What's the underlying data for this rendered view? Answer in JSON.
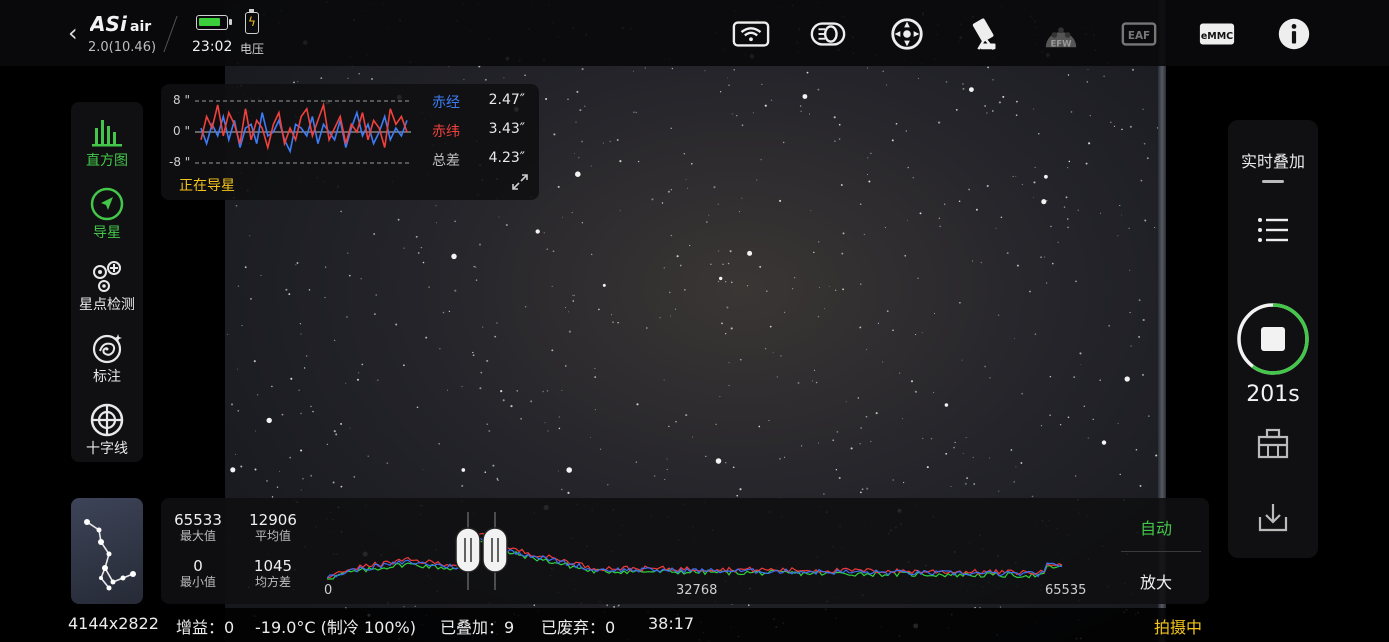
{
  "app": {
    "firmware": "2.0(10.46)",
    "time": "23:02",
    "voltage_label": "电压",
    "battery_level": 0.8
  },
  "top_icons": [
    "wifi-icon",
    "storage-disk-icon",
    "mount-icon",
    "telescope-icon",
    "efw-icon",
    "eaf-icon",
    "emmc-icon",
    "info-icon"
  ],
  "top_icon_labels": {
    "efw": "EFW",
    "eaf": "EAF",
    "emmc": "eMMC"
  },
  "left_tools": [
    {
      "id": "histogram",
      "label": "直方图",
      "active": true
    },
    {
      "id": "guide",
      "label": "导星",
      "active": true
    },
    {
      "id": "star-detect",
      "label": "星点检测",
      "active": false
    },
    {
      "id": "annotate",
      "label": "标注",
      "active": false
    },
    {
      "id": "crosshair",
      "label": "十字线",
      "active": false
    }
  ],
  "guide": {
    "ticks": [
      "8 \"",
      "0 \"",
      "-8 \""
    ],
    "ra_label": "赤经",
    "ra_value": "2.47″",
    "dec_label": "赤纬",
    "dec_value": "3.43″",
    "total_label": "总差",
    "total_value": "4.23″",
    "status": "正在导星",
    "colors": {
      "ra": "#3d7cf5",
      "dec": "#f0413c"
    },
    "ra_series": [
      1,
      -3,
      2,
      -1,
      4,
      -2,
      3,
      -4,
      1,
      2,
      -3,
      5,
      -1,
      0,
      3,
      -2,
      -5,
      2,
      1,
      -1,
      4,
      -3,
      2,
      0,
      -2,
      3,
      -4,
      1,
      5,
      -1,
      2,
      -3,
      0,
      4,
      -2,
      1,
      -1,
      3
    ],
    "dec_series": [
      -2,
      4,
      1,
      7,
      -1,
      5,
      2,
      -3,
      6,
      -2,
      3,
      1,
      -4,
      2,
      5,
      -3,
      1,
      -2,
      4,
      6,
      -1,
      3,
      7,
      -2,
      1,
      4,
      -3,
      2,
      0,
      5,
      -2,
      3,
      1,
      -4,
      6,
      2,
      4,
      0
    ]
  },
  "right_panel": {
    "title": "实时叠加",
    "exposure": "201s",
    "progress": 0.6
  },
  "histogram": {
    "max_value": "65533",
    "max_label": "最大值",
    "mean_value": "12906",
    "mean_label": "平均值",
    "min_value": "0",
    "min_label": "最小值",
    "std_value": "1045",
    "std_label": "均方差",
    "axis": [
      "0",
      "32768",
      "65535"
    ],
    "auto_label": "自动",
    "zoom_label": "放大"
  },
  "status": {
    "resolution": "4144x2822",
    "gain": "增益：0",
    "temperature": "-19.0°C (制冷 100%)",
    "stacked": "已叠加：9",
    "discarded": "已废弃：0",
    "elapsed": "38:17",
    "state": "拍摄中"
  }
}
